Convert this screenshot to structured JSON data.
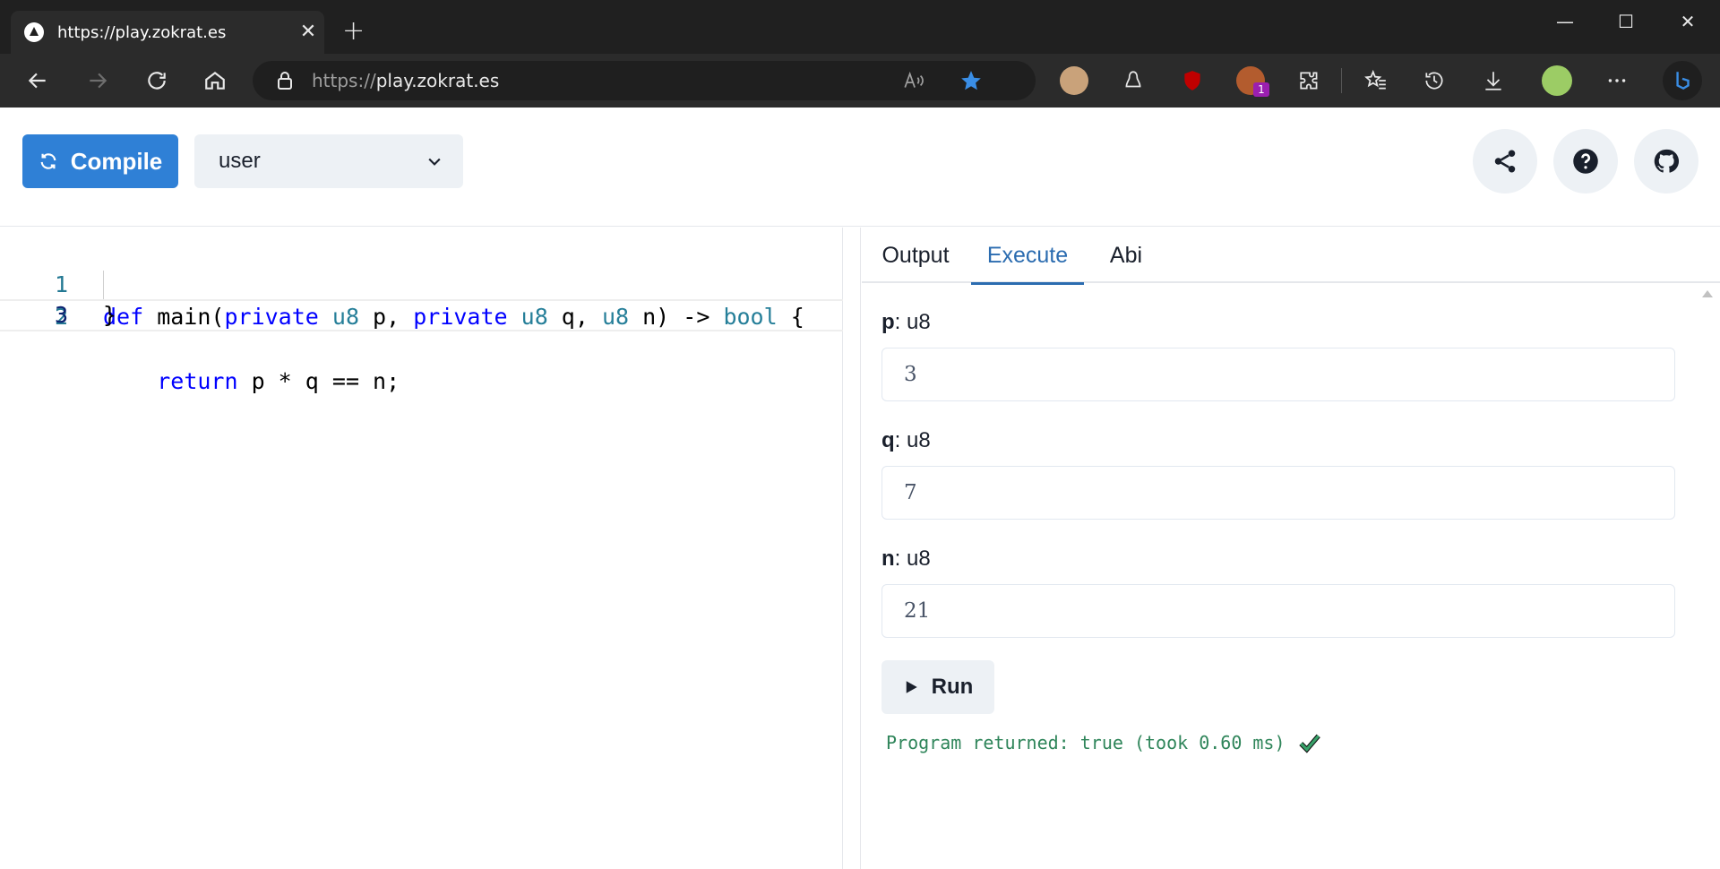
{
  "browser": {
    "tab_title": "https://play.zokrat.es",
    "url_scheme": "https://",
    "url_host": "play.zokrat.es",
    "extension_badge": "1"
  },
  "header": {
    "compile_label": "Compile",
    "select_value": "user"
  },
  "editor": {
    "lines": [
      {
        "number": "1"
      },
      {
        "number": "2"
      },
      {
        "number": "3"
      }
    ],
    "code": {
      "l1_def": "def",
      "l1_main": " main(",
      "l1_private1": "private",
      "l1_sp1": " ",
      "l1_u8a": "u8",
      "l1_p": " p, ",
      "l1_private2": "private",
      "l1_sp2": " ",
      "l1_u8b": "u8",
      "l1_q": " q, ",
      "l1_u8c": "u8",
      "l1_n": " n) -> ",
      "l1_bool": "bool",
      "l1_brace": " {",
      "l2_indent": "    ",
      "l2_return": "return",
      "l2_expr": " p * q == n;",
      "l3_brace": "}"
    }
  },
  "panel": {
    "tabs": [
      {
        "label": "Output"
      },
      {
        "label": "Execute"
      },
      {
        "label": "Abi"
      }
    ],
    "fields": [
      {
        "name": "p",
        "type": ": u8",
        "value": "3"
      },
      {
        "name": "q",
        "type": ": u8",
        "value": "7"
      },
      {
        "name": "n",
        "type": ": u8",
        "value": "21"
      }
    ],
    "run_label": "Run",
    "result_text": "Program returned: true (took 0.60 ms)"
  },
  "colors": {
    "accent": "#2f80d6",
    "tab_active": "#2b6cb0",
    "success": "#2f855a"
  }
}
